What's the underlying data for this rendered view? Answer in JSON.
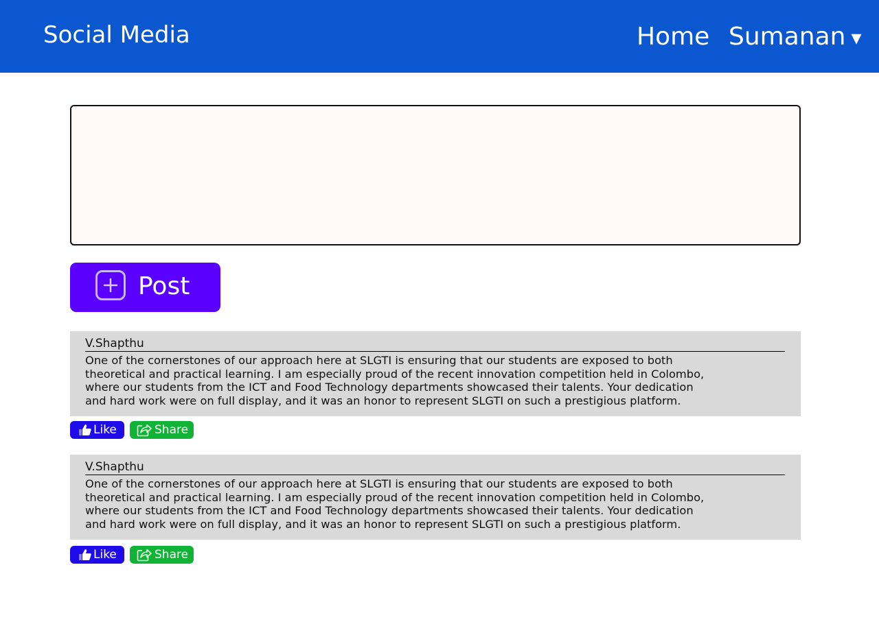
{
  "navbar": {
    "brand": "Social Media",
    "home_label": "Home",
    "user_label": "Sumanan",
    "user_caret": "▾",
    "background_color": "#0b57d0"
  },
  "composer": {
    "value": "",
    "placeholder": ""
  },
  "post_button": {
    "label": "Post",
    "icon": "plus-square-icon",
    "color": "#5a00ff"
  },
  "posts": [
    {
      "author": "V.Shapthu",
      "lines": [
        "One of the cornerstones of our approach here at SLGTI is ensuring that our students are exposed to both",
        "theoretical and practical learning. I am especially proud of the recent innovation competition held in Colombo,",
        "where our students from the ICT and Food Technology departments showcased their talents. Your dedication",
        "and hard work were on full display, and it was an honor to represent SLGTI on such a prestigious platform."
      ],
      "like_label": "Like",
      "share_label": "Share"
    },
    {
      "author": "V.Shapthu",
      "lines": [
        "One of the cornerstones of our approach here at SLGTI is ensuring that our students are exposed to both",
        "theoretical and practical learning. I am especially proud of the recent innovation competition held in Colombo,",
        "where our students from the ICT and Food Technology departments showcased their talents. Your dedication",
        "and hard work were on full display, and it was an honor to represent SLGTI on such a prestigious platform."
      ],
      "like_label": "Like",
      "share_label": "Share"
    }
  ],
  "colors": {
    "like": "#1f0be8",
    "share": "#10b335",
    "card": "#d9d9d9"
  }
}
